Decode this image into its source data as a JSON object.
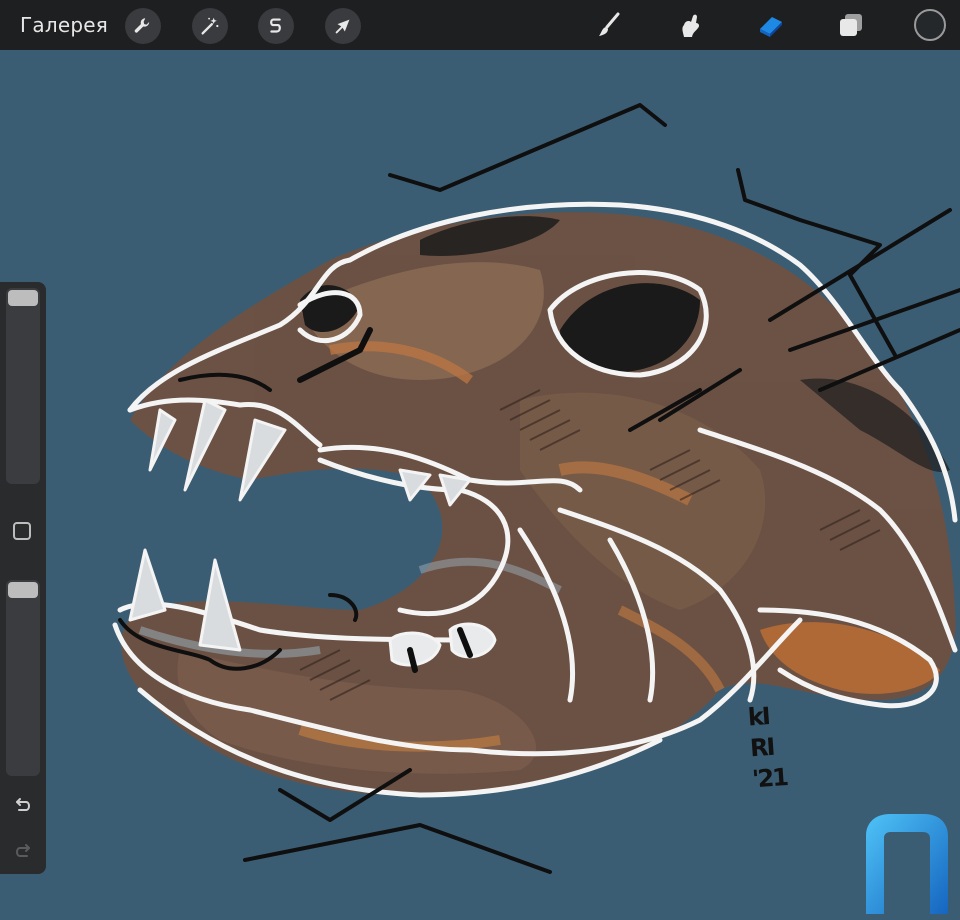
{
  "toolbar": {
    "gallery_label": "Галерея",
    "left_tools": [
      "wrench-icon",
      "magic-wand-icon",
      "selection-icon",
      "transform-arrow-icon"
    ],
    "right_tools": [
      "brush-icon",
      "smudge-icon",
      "eraser-icon",
      "layers-icon"
    ],
    "active_tool": "eraser-icon",
    "accent_color": "#1e88e5",
    "current_color": "#24282a"
  },
  "canvas": {
    "background_color": "#3b5d73",
    "signature_lines": [
      "kI",
      "RI",
      "'21"
    ]
  },
  "sidebar": {
    "brush_size_level": 0.0,
    "opacity_level": 0.0,
    "controls": [
      "brush-size-slider",
      "modify-button",
      "opacity-slider",
      "undo-icon",
      "redo-icon"
    ]
  },
  "watermark": {
    "logo": "п-logo",
    "color": "#1e88e5"
  }
}
